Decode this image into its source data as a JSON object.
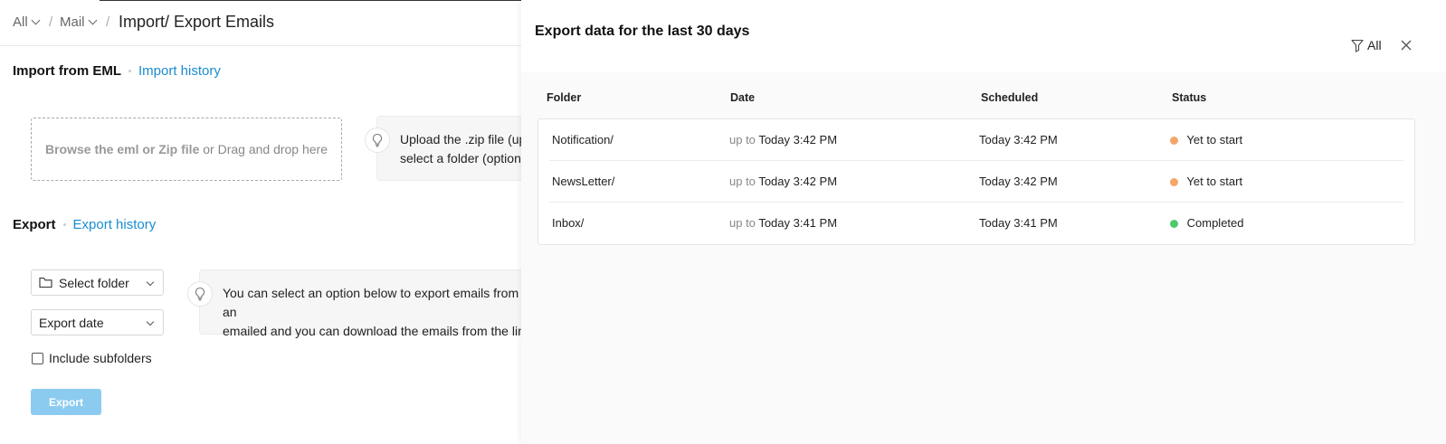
{
  "breadcrumb": {
    "all_label": "All",
    "mail_label": "Mail",
    "separator": "/",
    "title": "Import/ Export Emails"
  },
  "import_section": {
    "title": "Import from EML",
    "history_link": "Import history",
    "dropzone_strong": "Browse the eml or Zip file",
    "dropzone_rest": " or Drag and drop here",
    "tip_line1": "Upload the .zip file (up",
    "tip_line2": "select a folder (optiona"
  },
  "export_section": {
    "title": "Export",
    "history_link": "Export history",
    "folder_select": "Select folder",
    "date_select": "Export date",
    "include_subfolders": "Include subfolders",
    "export_button": "Export",
    "tip_line1": "You can select an option below to export emails from an",
    "tip_line2": "emailed and you can download the emails from the link"
  },
  "panel": {
    "title": "Export data for the last 30 days",
    "filter_label": "All",
    "columns": [
      "Folder",
      "Date",
      "Scheduled",
      "Status"
    ],
    "rows": [
      {
        "folder": "Notification/",
        "date_prefix": "up to",
        "date": "Today 3:42 PM",
        "scheduled": "Today 3:42 PM",
        "status": "Yet to start",
        "status_color": "#f5a66b"
      },
      {
        "folder": "NewsLetter/",
        "date_prefix": "up to",
        "date": "Today 3:42 PM",
        "scheduled": "Today 3:42 PM",
        "status": "Yet to start",
        "status_color": "#f5a66b"
      },
      {
        "folder": "Inbox/",
        "date_prefix": "up to",
        "date": "Today 3:41 PM",
        "scheduled": "Today 3:41 PM",
        "status": "Completed",
        "status_color": "#4cc96b"
      }
    ]
  },
  "colors": {
    "link": "#1a8dd1",
    "export_button_disabled": "#8ccbf0",
    "status_pending": "#f5a66b",
    "status_done": "#4cc96b"
  }
}
